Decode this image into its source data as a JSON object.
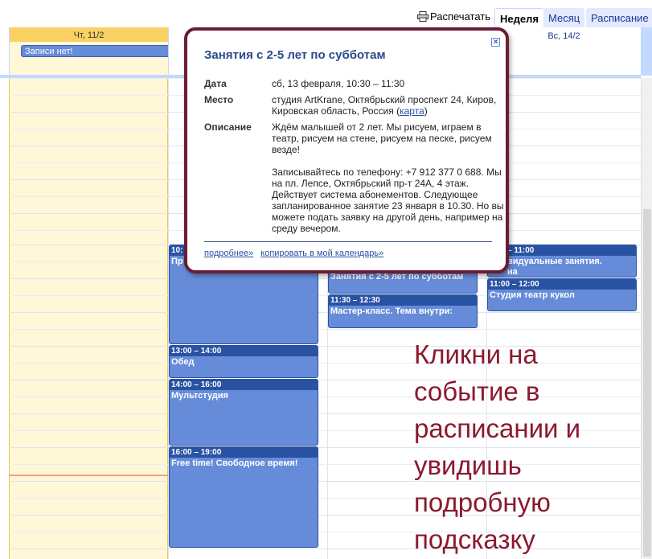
{
  "toolbar": {
    "print_label": "Распечатать",
    "tabs": [
      {
        "label": "Неделя",
        "active": true
      },
      {
        "label": "Месяц",
        "active": false
      },
      {
        "label": "Расписание",
        "active": false
      }
    ]
  },
  "days": {
    "thu": {
      "label": "Чт, 11/2",
      "allday": "Записи нет!"
    },
    "sun": {
      "label": "Вс, 14/2"
    }
  },
  "events": {
    "fri_1000": {
      "time": "10:",
      "name": "Пр"
    },
    "fri_1300": {
      "time": "13:00 – 14:00",
      "name": "Обед"
    },
    "fri_1400": {
      "time": "14:00 – 16:00",
      "name": "Мультстудия"
    },
    "fri_1600": {
      "time": "16:00 – 19:00",
      "name": "Free time! Свободное время!"
    },
    "sat_1030": {
      "name": "Занятия с 2-5 лет по субботам"
    },
    "sat_1130": {
      "time": "11:30 – 12:30",
      "name": "Мастер-класс. Тема внутри:"
    },
    "sun_1000": {
      "time": "– 11:00",
      "name": "видуальные занятия.",
      "extra": "на"
    },
    "sun_1100": {
      "time": "11:00 – 12:00",
      "name": "Студия театр кукол"
    }
  },
  "popup": {
    "title": "Занятия с 2-5 лет по субботам",
    "date_label": "Дата",
    "date_value": "сб, 13 февраля, 10:30 – 11:30",
    "place_label": "Место",
    "place_value": "студия ArtKrane, Октябрьский проспект 24, Киров, Кировская область, Россия (",
    "place_link": "карта",
    "place_end": ")",
    "desc_label": "Описание",
    "desc_p1": "Ждём малышей от 2 лет. Мы рисуем, играем в театр, рисуем на стене, рисуем на песке, рисуем везде!",
    "desc_p2": "Записывайтесь по телефону: +7 912 377 0 688. Мы на пл. Лепсе, Октябрьский пр-т 24А, 4 этаж. Действует система абонементов. Следующее запланированное занятие 23 января в 10.30. Но вы можете подать заявку на другой день, например на среду вечером.",
    "link_more": "подробнее»",
    "link_copy": "копировать в мой календарь»"
  },
  "annotation": "Кликни на событие в расписании и увидишь подробную подсказку",
  "colors": {
    "event_bg": "#668cd9",
    "event_header": "#2952a3",
    "today_bg": "#fff7d6",
    "popup_border": "#6b1b35",
    "annotation": "#8b1a2e"
  }
}
